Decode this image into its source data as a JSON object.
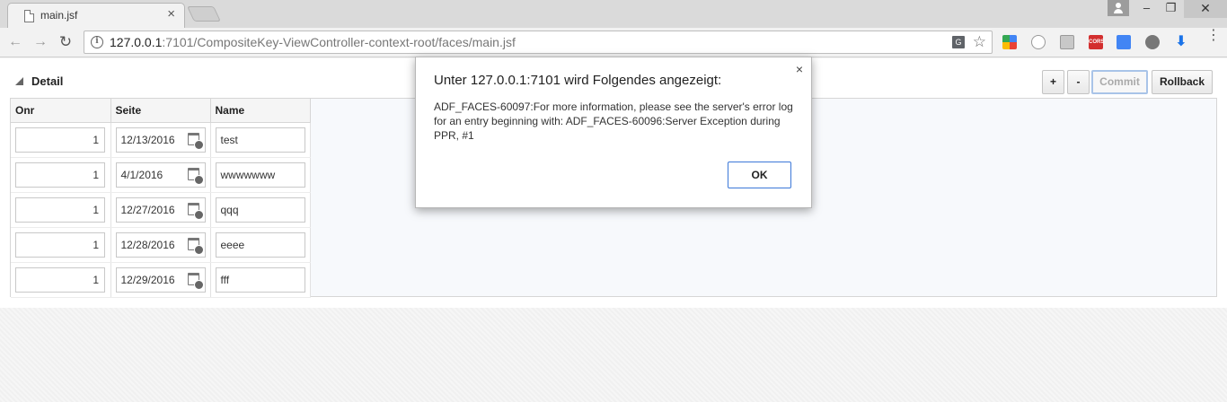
{
  "browser": {
    "tab": {
      "title": "main.jsf",
      "close": "×"
    },
    "window_controls": {
      "minimize": "–",
      "maximize": "❐",
      "close": "✕"
    },
    "nav": {
      "back": "←",
      "forward": "→",
      "reload": "↻"
    },
    "address": {
      "host": "127.0.0.1",
      "path": ":7101/CompositeKey-ViewController-context-root/faces/main.jsf"
    },
    "icons": {
      "info": "i",
      "star": "☆",
      "translate": "G",
      "extension_cors": "CORS",
      "menu": "⋮"
    }
  },
  "panel": {
    "title": "Detail",
    "toolbar": {
      "add_label": "+",
      "delete_label": "-",
      "commit_label": "Commit",
      "rollback_label": "Rollback"
    }
  },
  "table": {
    "columns": [
      "Onr",
      "Seite",
      "Name"
    ],
    "rows": [
      {
        "onr": "1",
        "seite": "12/13/2016",
        "name": "test"
      },
      {
        "onr": "1",
        "seite": "4/1/2016",
        "name": "wwwwwww"
      },
      {
        "onr": "1",
        "seite": "12/27/2016",
        "name": "qqq"
      },
      {
        "onr": "1",
        "seite": "12/28/2016",
        "name": "eeee"
      },
      {
        "onr": "1",
        "seite": "12/29/2016",
        "name": "fff"
      }
    ]
  },
  "dialog": {
    "title": "Unter 127.0.0.1:7101 wird Folgendes angezeigt:",
    "message": "ADF_FACES-60097:For more information, please see the server's error log for an entry beginning with: ADF_FACES-60096:Server Exception during PPR, #1",
    "ok_label": "OK",
    "close": "×"
  }
}
